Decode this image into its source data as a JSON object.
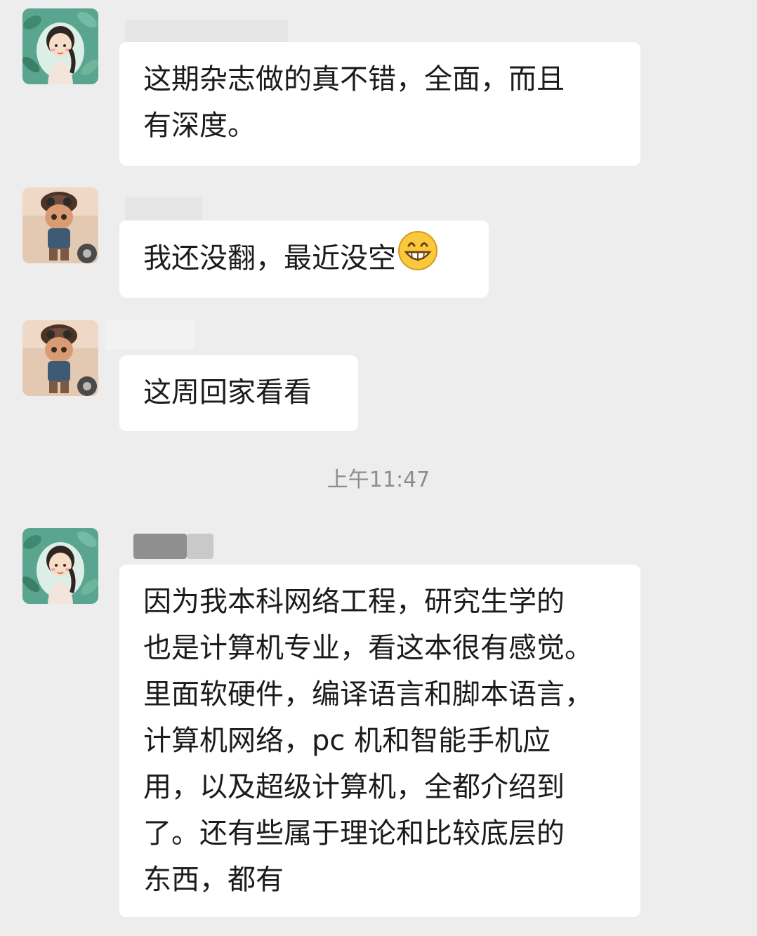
{
  "chat": {
    "messages": [
      {
        "avatar": "girl-avatar",
        "lines": [
          "这期杂志做的真不错，全面，而且",
          "有深度。"
        ]
      },
      {
        "avatar": "doll-avatar",
        "lines": [
          "我还没翻，最近没空"
        ],
        "emoji": "grinning-face-icon"
      },
      {
        "avatar": "doll-avatar",
        "lines": [
          "这周回家看看"
        ]
      },
      {
        "avatar": "girl-avatar",
        "lines": [
          "因为我本科网络工程，研究生学的",
          "也是计算机专业，看这本很有感觉。",
          "里面软硬件，编译语言和脚本语言，",
          "计算机网络，pc 机和智能手机应",
          "用，以及超级计算机，全都介绍到",
          "了。还有些属于理论和比较底层的",
          "东西，都有"
        ]
      }
    ],
    "timestamp": "上午11:47"
  },
  "colors": {
    "background": "#ededed",
    "bubble": "#ffffff",
    "text": "#1b1b1b",
    "timestamp": "#8d8d8d"
  }
}
